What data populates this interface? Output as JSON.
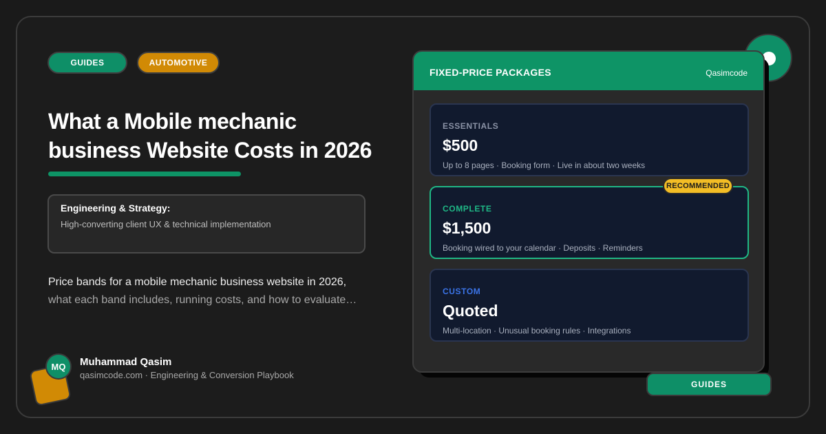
{
  "tags": {
    "guides": "GUIDES",
    "automotive": "AUTOMOTIVE"
  },
  "headline": {
    "line1": "What a Mobile mechanic",
    "line2": "business Website Costs in 2026"
  },
  "highlight": {
    "title": "Engineering & Strategy:",
    "subtitle": "High-converting client UX & technical implementation"
  },
  "description": {
    "line1": "Price bands for a mobile mechanic business website in 2026,",
    "line2": "what each band includes, running costs, and how to evaluate…"
  },
  "author": {
    "initials": "MQ",
    "name": "Muhammad Qasim",
    "byline": "qasimcode.com · Engineering & Conversion Playbook"
  },
  "packages": {
    "header_title": "FIXED-PRICE PACKAGES",
    "brand": "Qasimcode",
    "badge": "RECOMMENDED",
    "tiers": [
      {
        "label": "ESSENTIALS",
        "price": "$500",
        "details": "Up to 8 pages · Booking form · Live in about two weeks"
      },
      {
        "label": "COMPLETE",
        "price": "$1,500",
        "details": "Booking wired to your calendar · Deposits · Reminders"
      },
      {
        "label": "CUSTOM",
        "price": "Quoted",
        "details": "Multi-location · Unusual booking rules · Integrations"
      }
    ]
  },
  "footer_tag": "GUIDES",
  "colors": {
    "green": "#0e8f67",
    "amber": "#d18a05",
    "badge_yellow": "#f3bd25",
    "tier_blue": "#3b74e8",
    "background": "#1a1a1a"
  }
}
